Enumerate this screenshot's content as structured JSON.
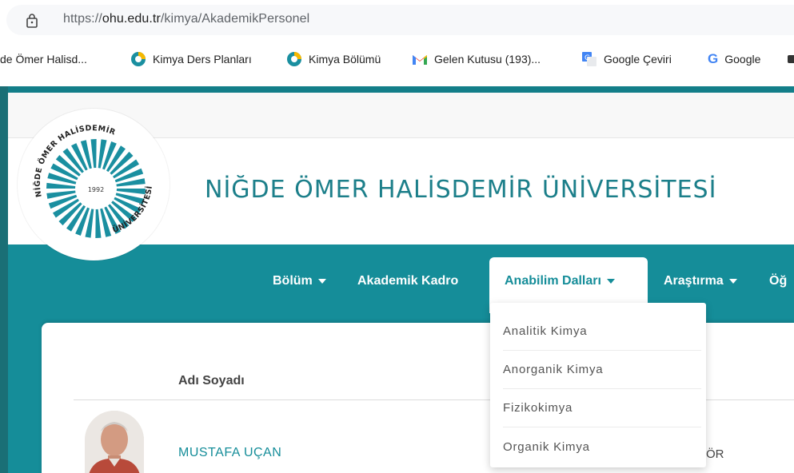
{
  "browser": {
    "url_host": "ohu.edu.tr",
    "url_scheme": "https://",
    "url_path": "/kimya/AkademikPersonel"
  },
  "bookmarks": [
    {
      "label": "de Ömer Halisd...",
      "icon": "none"
    },
    {
      "label": "Kimya Ders Planları",
      "icon": "site-favicon"
    },
    {
      "label": "Kimya Bölümü",
      "icon": "site-favicon"
    },
    {
      "label": "Gelen Kutusu (193)...",
      "icon": "gmail-icon"
    },
    {
      "label": "Google Çeviri",
      "icon": "google-translate-icon"
    },
    {
      "label": "Google",
      "icon": "google-icon"
    }
  ],
  "site": {
    "title": "NİĞDE ÖMER HALİSDEMİR ÜNİVERSİTESİ",
    "logo": {
      "year": "1992",
      "ring_top": "NİĞDE ÖMER HALİSDEMİR",
      "ring_bottom": "ÜNİVERSİTESİ"
    }
  },
  "nav": {
    "items": [
      {
        "label": "Bölüm",
        "has_caret": true
      },
      {
        "label": "Akademik Kadro",
        "has_caret": false
      },
      {
        "label": "Anabilim Dalları",
        "has_caret": true,
        "active": true
      },
      {
        "label": "Araştırma",
        "has_caret": true
      },
      {
        "label": "Öğ",
        "has_caret": false
      }
    ]
  },
  "dropdown": {
    "items": [
      "Analitik Kimya",
      "Anorganik Kimya",
      "Fizikokimya",
      "Organik Kimya"
    ]
  },
  "table": {
    "header": "Adı Soyadı",
    "rows": [
      {
        "name": "MUSTAFA UÇAN",
        "role_fragment": "ÖR"
      }
    ]
  },
  "colors": {
    "brand_teal": "#158d99",
    "title_teal": "#1c7f8a"
  }
}
